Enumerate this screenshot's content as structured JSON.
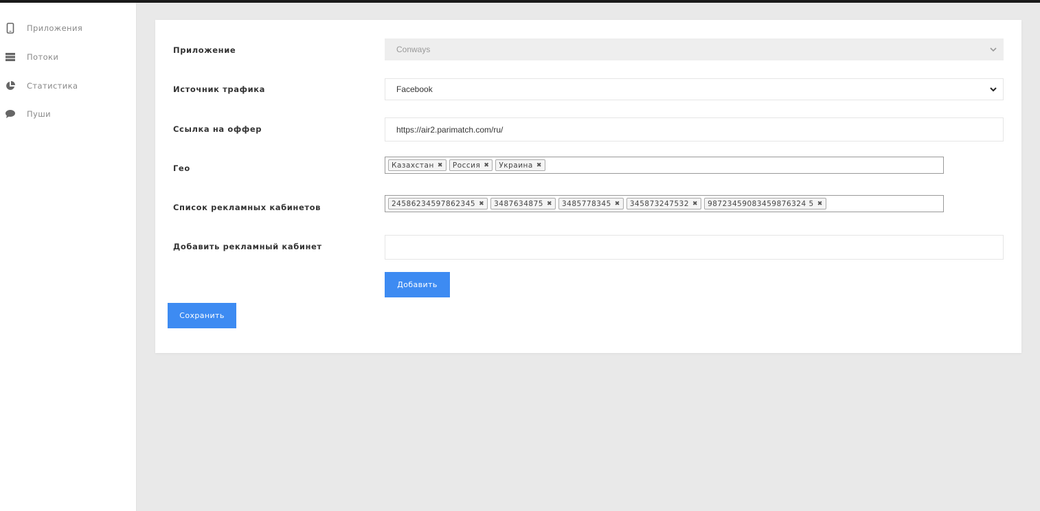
{
  "sidebar": {
    "items": [
      {
        "label": "Приложения",
        "icon": "mobile-icon"
      },
      {
        "label": "Потоки",
        "icon": "server-icon"
      },
      {
        "label": "Статистика",
        "icon": "pie-chart-icon"
      },
      {
        "label": "Пуши",
        "icon": "chat-bubble-icon"
      }
    ]
  },
  "form": {
    "app": {
      "label": "Приложение",
      "value": "Conways"
    },
    "traffic": {
      "label": "Источник трафика",
      "value": "Facebook"
    },
    "offer": {
      "label": "Ссылка на оффер",
      "value": "https://air2.parimatch.com/ru/"
    },
    "geo": {
      "label": "Гео",
      "tags": [
        "Казахстан",
        "Россия",
        "Украина"
      ]
    },
    "cabinets": {
      "label": "Список рекламных кабинетов",
      "tags": [
        "24586234597862345",
        "3487634875",
        "3485778345",
        "345873247532",
        "98723459083459876324 5"
      ]
    },
    "add_cabinet": {
      "label": "Добавить рекламный кабинет",
      "value": ""
    },
    "add_button": "Добавить",
    "save_button": "Сохранить"
  },
  "colors": {
    "accent": "#3d8bf2",
    "sidebar_bg": "#ffffff",
    "page_bg": "#e9e9e9"
  }
}
